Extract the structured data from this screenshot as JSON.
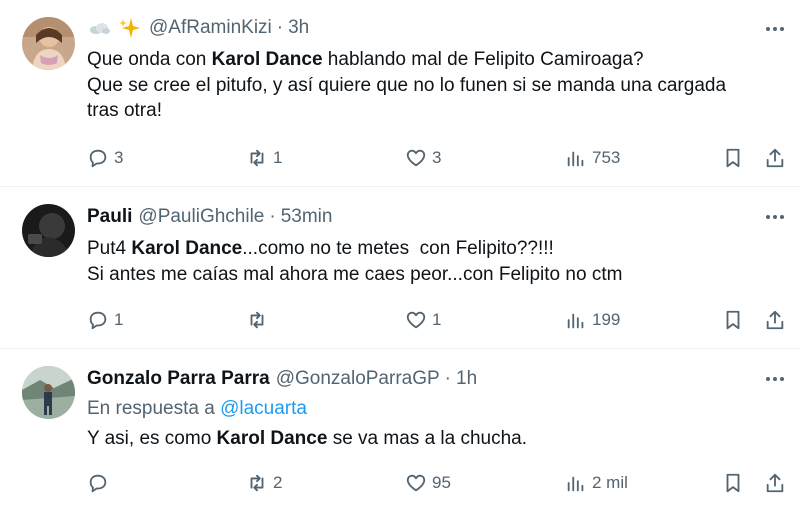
{
  "tweets": [
    {
      "name": "",
      "name_emoji": [
        "cloud-icon",
        "sparkles-icon"
      ],
      "handle": "@AfRaminKizi",
      "dot": "·",
      "time": "3h",
      "text_lines": [
        [
          "Que onda con ",
          "Karol Dance",
          " hablando mal de Felipito Camiroaga?"
        ],
        [
          "Que se cree el pitufo, y así quiere que no lo funen si se manda una cargada"
        ],
        [
          "tras otra!"
        ]
      ],
      "replies": "3",
      "reposts": "1",
      "likes": "3",
      "views": "753"
    },
    {
      "name": "Pauli",
      "handle": "@PauliGhchile",
      "dot": "·",
      "time": "53min",
      "text_lines": [
        [
          "Put4 ",
          "Karol Dance",
          "...como no te metes  con Felipito??!!!"
        ],
        [
          "Si antes me caías mal ahora me caes peor...con Felipito no ctm"
        ]
      ],
      "replies": "1",
      "reposts": "",
      "likes": "1",
      "views": "199"
    },
    {
      "name": "Gonzalo Parra Parra",
      "handle": "@GonzaloParraGP",
      "dot": "·",
      "time": "1h",
      "reply_prefix": "En respuesta a",
      "reply_handle": "@lacuarta",
      "text_lines": [
        [
          "Y asi, es como ",
          "Karol Dance",
          " se va mas a la chucha."
        ]
      ],
      "replies": "",
      "reposts": "2",
      "likes": "95",
      "views": "2 mil"
    }
  ],
  "colors": {
    "text": "#0f1419",
    "secondary": "#536471",
    "link": "#1d9bf0",
    "divider": "#eff3f4"
  }
}
